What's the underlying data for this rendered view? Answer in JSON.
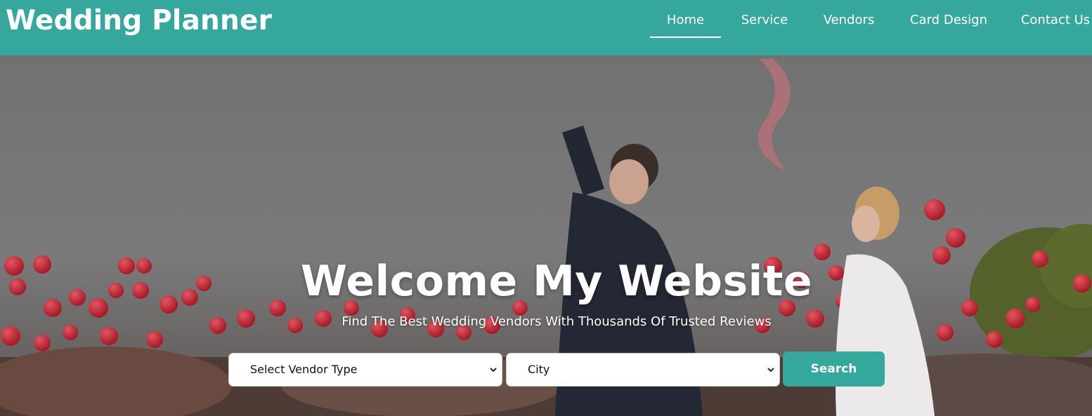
{
  "brand": "Wedding Planner",
  "nav": {
    "home": "Home",
    "service": "Service",
    "vendors": "Vendors",
    "card_design": "Card Design",
    "contact": "Contact Us",
    "active": "Home"
  },
  "hero": {
    "title": "Welcome My Website",
    "subtitle": "Find The Best Wedding Vendors With Thousands Of Trusted Reviews",
    "image_description": "wedding-couple-balloons-photo"
  },
  "search": {
    "vendor_type_value": "Select Vendor Type",
    "city_value": "City",
    "button_label": "Search"
  },
  "colors": {
    "accent": "#36a79c",
    "text_light": "#ffffff"
  }
}
